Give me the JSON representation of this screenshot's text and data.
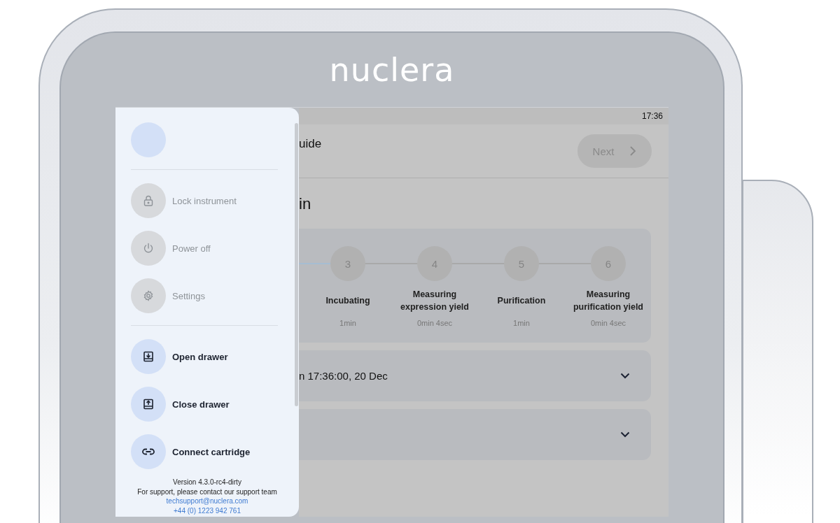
{
  "device": {
    "brand": "nuclera"
  },
  "status_bar": {
    "time": "17:36"
  },
  "drawer": {
    "groups": [
      {
        "items": [
          {
            "label": "Lock instrument",
            "kind": "lock",
            "disabled": true
          },
          {
            "label": "Power off",
            "kind": "power",
            "disabled": true
          },
          {
            "label": "Settings",
            "kind": "settings",
            "disabled": true
          }
        ]
      },
      {
        "items": [
          {
            "label": "Open drawer",
            "kind": "unload",
            "disabled": false
          },
          {
            "label": "Close drawer",
            "kind": "load",
            "disabled": false
          },
          {
            "label": "Connect cartridge",
            "kind": "connect",
            "disabled": false
          }
        ]
      }
    ],
    "footer": {
      "version": "Version 4.3.0-rc4-dirty",
      "support": "For support, please contact our support team",
      "email": "techsupport@nuclera.com",
      "phone": "+44 (0) 1223 942 761"
    }
  },
  "header": {
    "title": "uide",
    "next_button": "Next"
  },
  "section_title": "in",
  "steps": [
    {
      "number": "3",
      "label": "Incubating",
      "duration": "1min"
    },
    {
      "number": "4",
      "label": "Measuring expression yield",
      "duration": "0min 4sec"
    },
    {
      "number": "5",
      "label": "Purification",
      "duration": "1min"
    },
    {
      "number": "6",
      "label": "Measuring purification yield",
      "duration": "0min 4sec"
    }
  ],
  "accordions": [
    {
      "title": "n 17:36:00, 20 Dec",
      "expanded": false
    },
    {
      "expanded": false
    }
  ]
}
